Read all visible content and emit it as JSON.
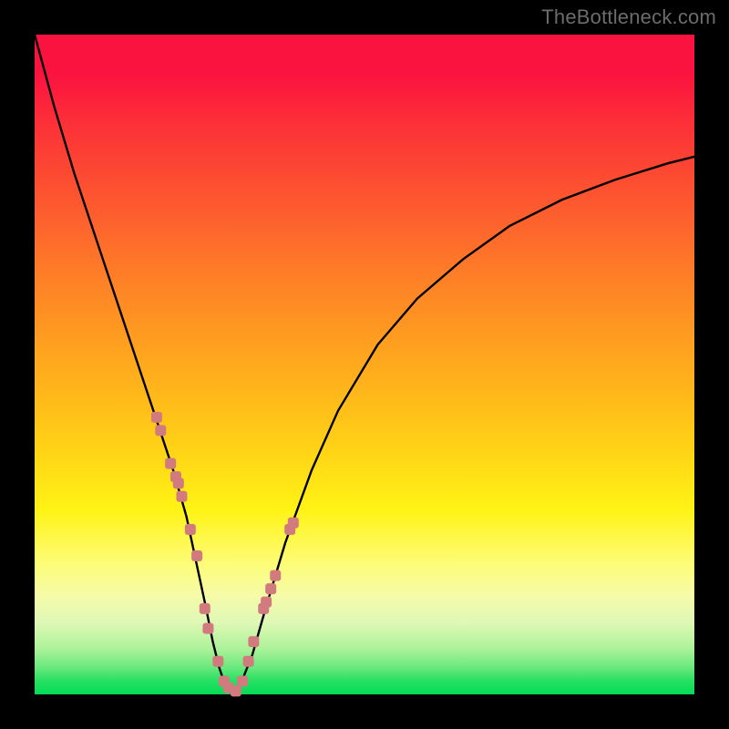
{
  "watermark": "TheBottleneck.com",
  "colors": {
    "frame": "#000000",
    "watermark_text": "#6c6c6c",
    "curve": "#000000",
    "marker_fill": "#d17b7e",
    "gradient": {
      "top": "#fb133f",
      "mid_high": "#fe8326",
      "mid": "#ffd016",
      "mid_low": "#fdfc75",
      "bottom": "#04dc56"
    }
  },
  "chart_data": {
    "type": "line",
    "title": "",
    "xlabel": "",
    "ylabel": "",
    "xlim": [
      0,
      100
    ],
    "ylim": [
      0,
      100
    ],
    "legend": false,
    "grid": false,
    "x": [
      0,
      3,
      6,
      9,
      12,
      15,
      17,
      19,
      21,
      23,
      24.5,
      26,
      27,
      28,
      29,
      30,
      31,
      33,
      35,
      38,
      42,
      46,
      52,
      58,
      65,
      72,
      80,
      88,
      96,
      100
    ],
    "y": [
      100,
      89,
      79,
      70,
      61,
      52,
      46,
      40,
      34,
      27,
      20,
      13,
      8,
      4,
      1,
      0,
      1,
      6,
      13,
      23,
      34,
      43,
      53,
      60,
      66,
      71,
      75,
      78,
      80.5,
      81.5
    ],
    "markers": {
      "x": [
        18.5,
        19.1,
        20.6,
        21.4,
        21.8,
        22.3,
        23.6,
        24.6,
        25.8,
        26.3,
        27.8,
        28.7,
        29.4,
        30.5,
        31.5,
        32.4,
        33.2,
        34.7,
        35.1,
        35.8,
        36.5,
        38.7,
        39.2
      ],
      "y": [
        42,
        40,
        35,
        33,
        32,
        30,
        25,
        21,
        13,
        10,
        5,
        2,
        1,
        0.5,
        2,
        5,
        8,
        13,
        14,
        16,
        18,
        25,
        26
      ]
    },
    "notes": "V-shaped curve with minimum near x≈30; salmon square markers clustered on both flanks of the trough. Axes have no visible ticks or labels; values estimated from pixel positions on a 0–100 normalized scale."
  }
}
